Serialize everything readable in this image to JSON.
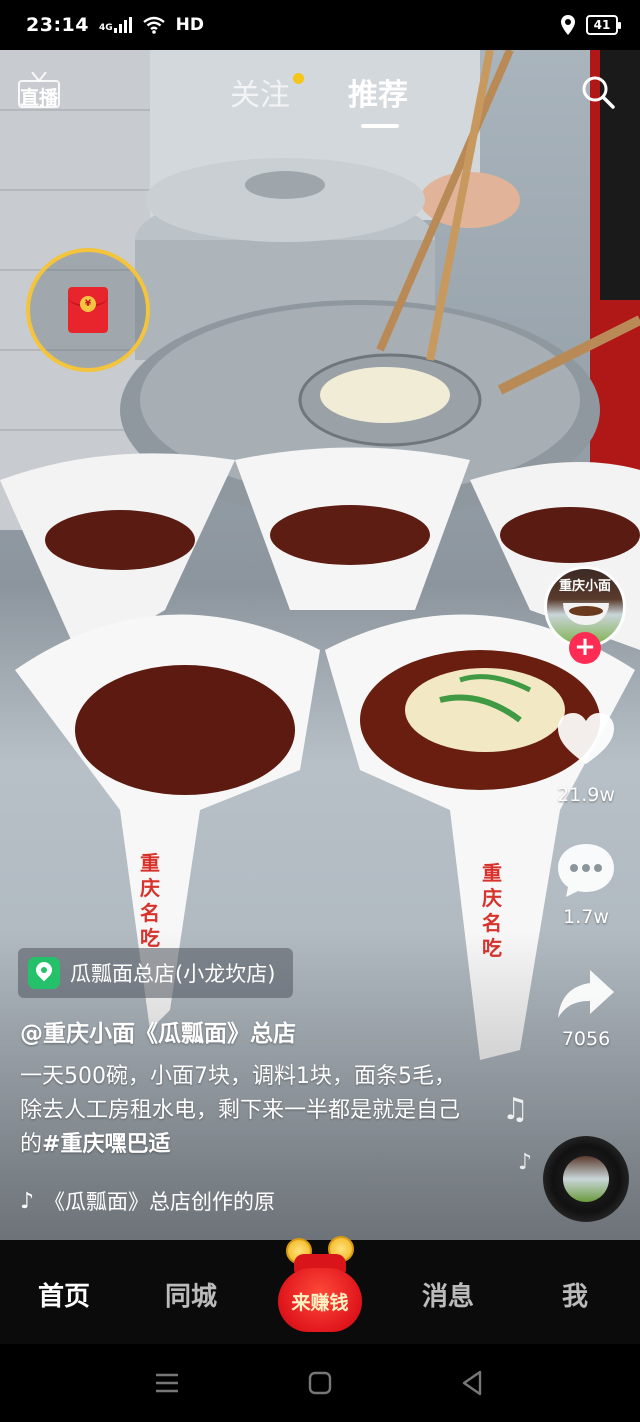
{
  "status_bar": {
    "time": "23:14",
    "network": "4G",
    "hd": "HD",
    "battery": "41"
  },
  "top_nav": {
    "live_label": "直播",
    "tabs": [
      {
        "label": "关注",
        "has_dot": true
      },
      {
        "label": "推荐",
        "active": true
      }
    ],
    "search_icon": "search-icon"
  },
  "red_packet": {
    "icon": "red-envelope-icon",
    "seal": "¥"
  },
  "right_rail": {
    "avatar_text": "重庆小面",
    "follow_icon": "+",
    "likes": "21.9w",
    "comments": "1.7w",
    "shares": "7056"
  },
  "video_info": {
    "location": "瓜瓢面总店(小龙坎店)",
    "author": "@重庆小面《瓜瓢面》总店",
    "caption": "一天500碗，小面7块，调料1块，面条5毛，除去人工房租水电，剩下来一半都是就是自己的",
    "hashtag": "#重庆嘿巴适",
    "music_text": "《瓜瓢面》总店创作的原",
    "bowl_text": "重庆名吃"
  },
  "tab_bar": {
    "home": "首页",
    "city": "同城",
    "earn": "来赚钱",
    "messages": "消息",
    "me": "我"
  },
  "colors": {
    "accent_red": "#fe2c55",
    "gold": "#f3c43c",
    "location_green": "#25c06a"
  }
}
